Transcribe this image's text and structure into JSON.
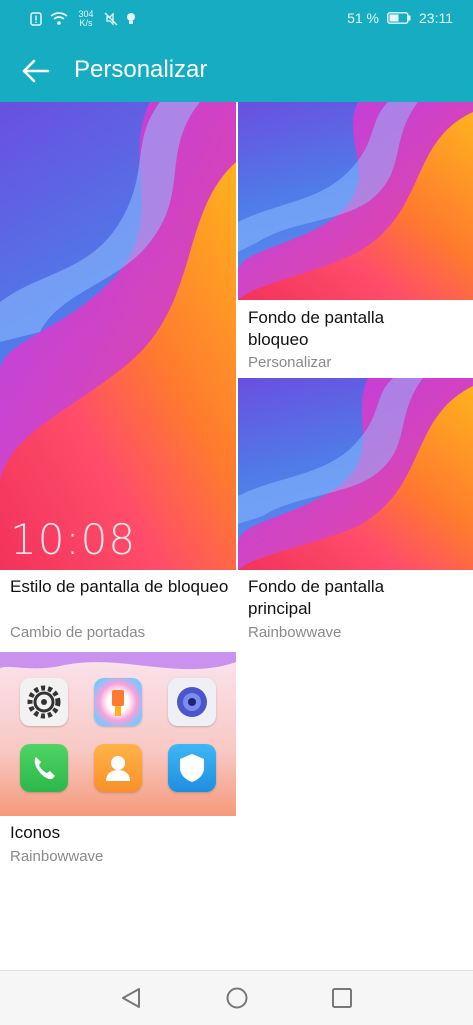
{
  "status_bar": {
    "net_speed_value": "304",
    "net_speed_unit": "K/s",
    "battery_percent": "51 %",
    "time": "23:11",
    "icons": [
      "alert-icon",
      "wifi-icon",
      "mute-icon",
      "bulb-icon",
      "signal-icon",
      "battery-icon"
    ]
  },
  "app_bar": {
    "title": "Personalizar",
    "back_icon": "arrow-left-icon"
  },
  "cards": {
    "lock_style": {
      "title": "Estilo de pantalla de bloqueo",
      "subtitle": "Cambio de portadas",
      "clock": "10:08"
    },
    "lock_wallpaper": {
      "title": "Fondo de pantalla bloqueo",
      "subtitle": "Personalizar"
    },
    "home_wallpaper": {
      "title": "Fondo de pantalla principal",
      "subtitle": "Rainbowwave"
    },
    "icons": {
      "title": "Iconos",
      "subtitle": "Rainbowwave",
      "app_icons": [
        "settings-icon",
        "themes-icon",
        "camera-icon",
        "phone-icon",
        "contacts-icon",
        "security-icon"
      ]
    }
  },
  "nav_bar": {
    "icons": [
      "back-triangle-icon",
      "home-circle-icon",
      "recents-square-icon"
    ]
  },
  "colors": {
    "accent": "#16adc2",
    "subtitle": "#8a8a8a",
    "title": "#111111"
  }
}
